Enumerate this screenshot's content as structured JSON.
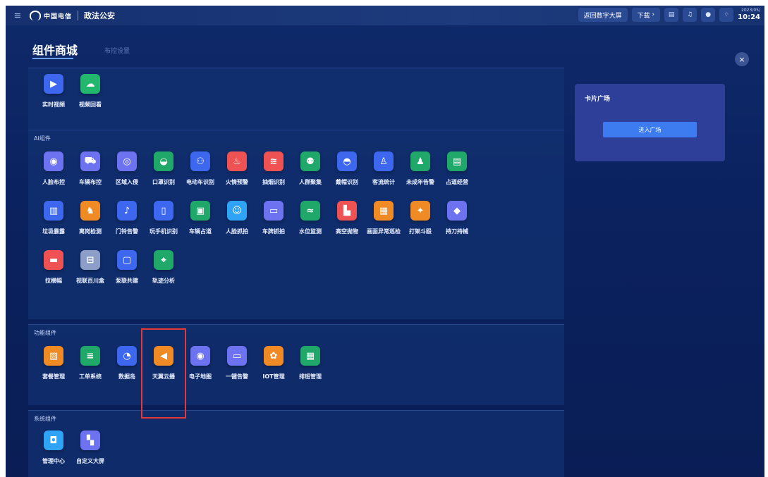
{
  "topbar": {
    "logo_text": "中国电信",
    "app_title": "政法公安",
    "back_button": "返回数字大屏",
    "download_button": "下载",
    "date": "2023/05/",
    "time": "10:24"
  },
  "page": {
    "title": "组件商城",
    "subtitle": "布控设置"
  },
  "sections": {
    "video": {
      "label": "",
      "items": [
        {
          "label": "实时视频",
          "icon": "play-icon",
          "glyph": "▶",
          "color": "c-navy"
        },
        {
          "label": "视频回看",
          "icon": "cloud-icon",
          "glyph": "☁",
          "color": "c-teal"
        }
      ]
    },
    "ai": {
      "label": "AI组件",
      "items": [
        {
          "label": "人脸布控",
          "icon": "face-icon",
          "glyph": "◉",
          "color": "c-purple"
        },
        {
          "label": "车辆布控",
          "icon": "car-icon",
          "glyph": "⛟",
          "color": "c-purple"
        },
        {
          "label": "区域入侵",
          "icon": "target-icon",
          "glyph": "◎",
          "color": "c-purple"
        },
        {
          "label": "口罩识别",
          "icon": "mask-icon",
          "glyph": "◒",
          "color": "c-green"
        },
        {
          "label": "电动车识别",
          "icon": "ebike-icon",
          "glyph": "⚇",
          "color": "c-navy"
        },
        {
          "label": "火情预警",
          "icon": "fire-icon",
          "glyph": "♨",
          "color": "c-red"
        },
        {
          "label": "抽烟识别",
          "icon": "smoke-icon",
          "glyph": "≋",
          "color": "c-red"
        },
        {
          "label": "人群聚集",
          "icon": "crowd-icon",
          "glyph": "⚉",
          "color": "c-green"
        },
        {
          "label": "戴帽识别",
          "icon": "helmet-icon",
          "glyph": "◓",
          "color": "c-navy"
        },
        {
          "label": "客流统计",
          "icon": "person-icon",
          "glyph": "♙",
          "color": "c-navy"
        },
        {
          "label": "未成年告警",
          "icon": "child-icon",
          "glyph": "♟",
          "color": "c-green"
        },
        {
          "label": "占道经营",
          "icon": "stall-icon",
          "glyph": "▤",
          "color": "c-green"
        },
        {
          "label": "垃圾暴露",
          "icon": "trash-icon",
          "glyph": "▥",
          "color": "c-navy"
        },
        {
          "label": "离岗检测",
          "icon": "leave-post-icon",
          "glyph": "♞",
          "color": "c-orange"
        },
        {
          "label": "门铃告警",
          "icon": "bell-icon",
          "glyph": "♪",
          "color": "c-navy"
        },
        {
          "label": "玩手机识别",
          "icon": "phone-icon",
          "glyph": "▯",
          "color": "c-navy"
        },
        {
          "label": "车辆占道",
          "icon": "lane-icon",
          "glyph": "▣",
          "color": "c-green"
        },
        {
          "label": "人脸抓拍",
          "icon": "face-capture-icon",
          "glyph": "☺",
          "color": "c-sky"
        },
        {
          "label": "车牌抓拍",
          "icon": "plate-icon",
          "glyph": "▭",
          "color": "c-purple"
        },
        {
          "label": "水位监测",
          "icon": "water-icon",
          "glyph": "≈",
          "color": "c-green"
        },
        {
          "label": "高空抛物",
          "icon": "building-icon",
          "glyph": "▙",
          "color": "c-red"
        },
        {
          "label": "画面异常巡检",
          "icon": "screen-check-icon",
          "glyph": "▦",
          "color": "c-orange"
        },
        {
          "label": "打架斗殴",
          "icon": "fight-icon",
          "glyph": "✦",
          "color": "c-orange"
        },
        {
          "label": "持刀持械",
          "icon": "knife-icon",
          "glyph": "◆",
          "color": "c-purple"
        },
        {
          "label": "拉横幅",
          "icon": "banner-icon",
          "glyph": "▬",
          "color": "c-red"
        },
        {
          "label": "视联百川盒",
          "icon": "box-icon",
          "glyph": "⊟",
          "color": "c-gray"
        },
        {
          "label": "泵联共建",
          "icon": "link-icon",
          "glyph": "▢",
          "color": "c-navy"
        },
        {
          "label": "轨迹分析",
          "icon": "location-icon",
          "glyph": "⌖",
          "color": "c-green"
        }
      ]
    },
    "func": {
      "label": "功能组件",
      "items": [
        {
          "label": "套餐管理",
          "icon": "package-icon",
          "glyph": "▧",
          "color": "c-orange"
        },
        {
          "label": "工单系统",
          "icon": "doc-icon",
          "glyph": "≡",
          "color": "c-green"
        },
        {
          "label": "数据岛",
          "icon": "pie-icon",
          "glyph": "◔",
          "color": "c-navy"
        },
        {
          "label": "天翼云播",
          "icon": "broadcast-icon",
          "glyph": "◀",
          "color": "c-orange"
        },
        {
          "label": "电子地图",
          "icon": "map-pin-icon",
          "glyph": "◉",
          "color": "c-purple"
        },
        {
          "label": "一键告警",
          "icon": "alarm-icon",
          "glyph": "▭",
          "color": "c-purple"
        },
        {
          "label": "IOT管理",
          "icon": "iot-icon",
          "glyph": "✿",
          "color": "c-orange"
        },
        {
          "label": "排班管理",
          "icon": "calendar-icon",
          "glyph": "▦",
          "color": "c-green"
        }
      ]
    },
    "sys": {
      "label": "系统组件",
      "items": [
        {
          "label": "管理中心",
          "icon": "admin-icon",
          "glyph": "◘",
          "color": "c-sky"
        },
        {
          "label": "自定义大屏",
          "icon": "dashboard-icon",
          "glyph": "▚",
          "color": "c-purple"
        }
      ]
    }
  },
  "card": {
    "title": "卡片广场",
    "button": "进入广场"
  },
  "colors": {
    "background": "#0b2260",
    "highlight": "#e53935",
    "card": "#2d3f98",
    "primary_button": "#3d7cf0"
  }
}
